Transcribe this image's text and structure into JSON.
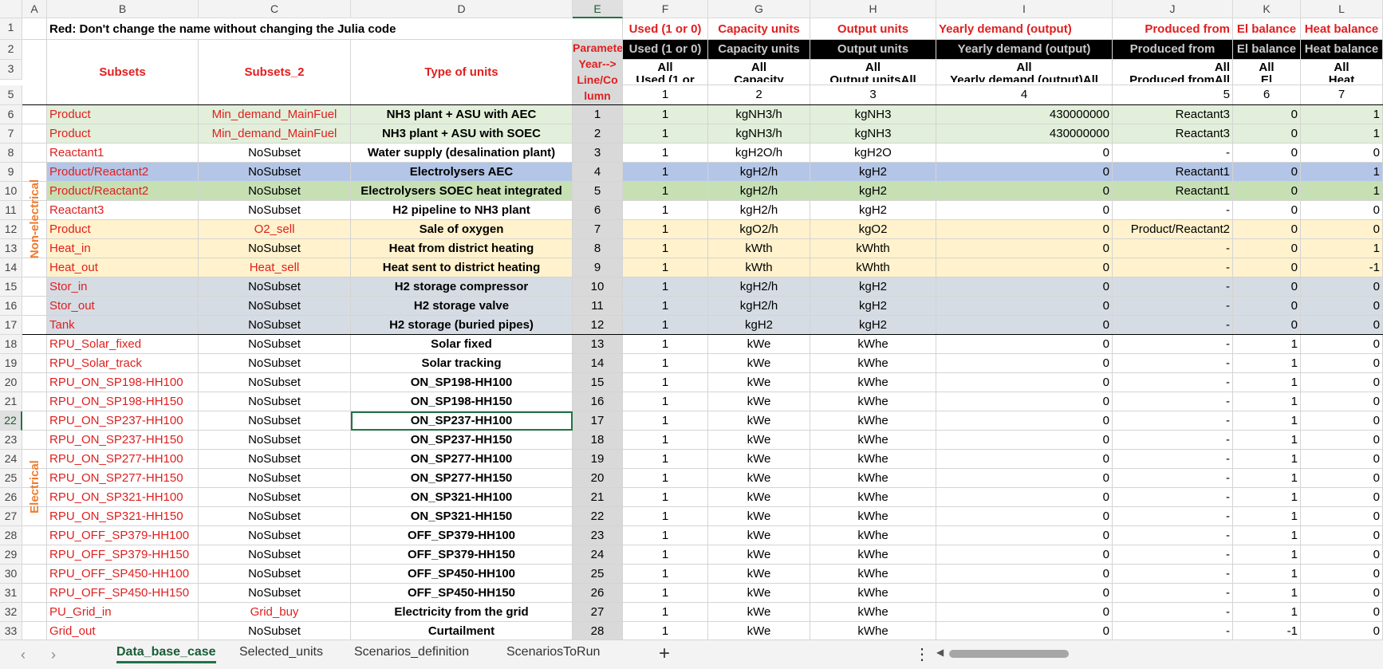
{
  "columns": [
    "A",
    "B",
    "C",
    "D",
    "E",
    "F",
    "G",
    "H",
    "I",
    "J",
    "K",
    "L"
  ],
  "selected_column": "E",
  "selected_row": "22",
  "row1": {
    "B": "Red: Don't change the name without changing the Julia code",
    "F": "Used (1 or 0)",
    "G": "Capacity units",
    "H": "Output units",
    "I": "Yearly demand (output)",
    "J": "Produced from",
    "K": "El balance",
    "L": "Heat balance"
  },
  "row2": {
    "E": "Parameters",
    "F": "Used (1 or 0)",
    "G": "Capacity units",
    "H": "Output units",
    "I": "Yearly demand (output)",
    "J": "Produced from",
    "K": "El balance",
    "L": "Heat balance"
  },
  "row3": {
    "B": "Subsets",
    "C": "Subsets_2",
    "D": "Type of units",
    "E": "Year-->",
    "F": "All",
    "G": "All",
    "H": "All",
    "I": "All",
    "J": "All",
    "K": "All",
    "L": "All"
  },
  "row3b": {
    "E": "Line/Co",
    "F": "Used (1 or",
    "G": "Capacity",
    "H": "Output unitsAll",
    "I": "Yearly demand (output)All",
    "J": "Produced fromAll",
    "K": "El",
    "L": "Heat"
  },
  "row5": {
    "E": "lumn",
    "F": "1",
    "G": "2",
    "H": "3",
    "I": "4",
    "J": "5",
    "K": "6",
    "L": "7"
  },
  "group_labels": {
    "non_electrical": "Non-electrical",
    "electrical": "Electrical"
  },
  "rows": [
    {
      "n": "6",
      "B": "Product",
      "C": "Min_demand_MainFuel",
      "D": "NH3 plant + ASU with AEC",
      "E": "1",
      "F": "1",
      "G": "kgNH3/h",
      "H": "kgNH3",
      "I": "430000000",
      "J": "Reactant3",
      "K": "0",
      "L": "1",
      "fill": "g-green"
    },
    {
      "n": "7",
      "B": "Product",
      "C": "Min_demand_MainFuel",
      "D": "NH3 plant + ASU with SOEC",
      "E": "2",
      "F": "1",
      "G": "kgNH3/h",
      "H": "kgNH3",
      "I": "430000000",
      "J": "Reactant3",
      "K": "0",
      "L": "1",
      "fill": "g-green"
    },
    {
      "n": "8",
      "B": "Reactant1",
      "C": "NoSubset",
      "D": "Water supply (desalination plant)",
      "E": "3",
      "F": "1",
      "G": "kgH2O/h",
      "H": "kgH2O",
      "I": "0",
      "J": "-",
      "K": "0",
      "L": "0",
      "fill": ""
    },
    {
      "n": "9",
      "B": "Product/Reactant2",
      "C": "NoSubset",
      "D": "Electrolysers AEC",
      "E": "4",
      "F": "1",
      "G": "kgH2/h",
      "H": "kgH2",
      "I": "0",
      "J": "Reactant1",
      "K": "0",
      "L": "1",
      "fill": "g-blue"
    },
    {
      "n": "10",
      "B": "Product/Reactant2",
      "C": "NoSubset",
      "D": "Electrolysers SOEC heat integrated",
      "E": "5",
      "F": "1",
      "G": "kgH2/h",
      "H": "kgH2",
      "I": "0",
      "J": "Reactant1",
      "K": "0",
      "L": "1",
      "fill": "g-green2"
    },
    {
      "n": "11",
      "B": "Reactant3",
      "C": "NoSubset",
      "D": "H2 pipeline to NH3 plant",
      "E": "6",
      "F": "1",
      "G": "kgH2/h",
      "H": "kgH2",
      "I": "0",
      "J": "-",
      "K": "0",
      "L": "0",
      "fill": ""
    },
    {
      "n": "12",
      "B": "Product",
      "C": "O2_sell",
      "D": "Sale of oxygen",
      "E": "7",
      "F": "1",
      "G": "kgO2/h",
      "H": "kgO2",
      "I": "0",
      "J": "Product/Reactant2",
      "K": "0",
      "L": "0",
      "fill": "g-orange"
    },
    {
      "n": "13",
      "B": "Heat_in",
      "C": "NoSubset",
      "D": "Heat from district heating",
      "E": "8",
      "F": "1",
      "G": "kWth",
      "H": "kWhth",
      "I": "0",
      "J": "-",
      "K": "0",
      "L": "1",
      "fill": "g-orange"
    },
    {
      "n": "14",
      "B": "Heat_out",
      "C": "Heat_sell",
      "D": "Heat sent to district heating",
      "E": "9",
      "F": "1",
      "G": "kWth",
      "H": "kWhth",
      "I": "0",
      "J": "-",
      "K": "0",
      "L": "-1",
      "fill": "g-orange"
    },
    {
      "n": "15",
      "B": "Stor_in",
      "C": "NoSubset",
      "D": "H2 storage compressor",
      "E": "10",
      "F": "1",
      "G": "kgH2/h",
      "H": "kgH2",
      "I": "0",
      "J": "-",
      "K": "0",
      "L": "0",
      "fill": "g-steel"
    },
    {
      "n": "16",
      "B": "Stor_out",
      "C": "NoSubset",
      "D": "H2 storage valve",
      "E": "11",
      "F": "1",
      "G": "kgH2/h",
      "H": "kgH2",
      "I": "0",
      "J": "-",
      "K": "0",
      "L": "0",
      "fill": "g-steel"
    },
    {
      "n": "17",
      "B": "Tank",
      "C": "NoSubset",
      "D": "H2 storage (buried pipes)",
      "E": "12",
      "F": "1",
      "G": "kgH2",
      "H": "kgH2",
      "I": "0",
      "J": "-",
      "K": "0",
      "L": "0",
      "fill": "g-steel"
    },
    {
      "n": "18",
      "B": "RPU_Solar_fixed",
      "C": "NoSubset",
      "D": "Solar fixed",
      "E": "13",
      "F": "1",
      "G": "kWe",
      "H": "kWhe",
      "I": "0",
      "J": "-",
      "K": "1",
      "L": "0",
      "fill": ""
    },
    {
      "n": "19",
      "B": "RPU_Solar_track",
      "C": "NoSubset",
      "D": "Solar tracking",
      "E": "14",
      "F": "1",
      "G": "kWe",
      "H": "kWhe",
      "I": "0",
      "J": "-",
      "K": "1",
      "L": "0",
      "fill": ""
    },
    {
      "n": "20",
      "B": "RPU_ON_SP198-HH100",
      "C": "NoSubset",
      "D": "ON_SP198-HH100",
      "E": "15",
      "F": "1",
      "G": "kWe",
      "H": "kWhe",
      "I": "0",
      "J": "-",
      "K": "1",
      "L": "0",
      "fill": ""
    },
    {
      "n": "21",
      "B": "RPU_ON_SP198-HH150",
      "C": "NoSubset",
      "D": "ON_SP198-HH150",
      "E": "16",
      "F": "1",
      "G": "kWe",
      "H": "kWhe",
      "I": "0",
      "J": "-",
      "K": "1",
      "L": "0",
      "fill": ""
    },
    {
      "n": "22",
      "B": "RPU_ON_SP237-HH100",
      "C": "NoSubset",
      "D": "ON_SP237-HH100",
      "E": "17",
      "F": "1",
      "G": "kWe",
      "H": "kWhe",
      "I": "0",
      "J": "-",
      "K": "1",
      "L": "0",
      "fill": ""
    },
    {
      "n": "23",
      "B": "RPU_ON_SP237-HH150",
      "C": "NoSubset",
      "D": "ON_SP237-HH150",
      "E": "18",
      "F": "1",
      "G": "kWe",
      "H": "kWhe",
      "I": "0",
      "J": "-",
      "K": "1",
      "L": "0",
      "fill": ""
    },
    {
      "n": "24",
      "B": "RPU_ON_SP277-HH100",
      "C": "NoSubset",
      "D": "ON_SP277-HH100",
      "E": "19",
      "F": "1",
      "G": "kWe",
      "H": "kWhe",
      "I": "0",
      "J": "-",
      "K": "1",
      "L": "0",
      "fill": ""
    },
    {
      "n": "25",
      "B": "RPU_ON_SP277-HH150",
      "C": "NoSubset",
      "D": "ON_SP277-HH150",
      "E": "20",
      "F": "1",
      "G": "kWe",
      "H": "kWhe",
      "I": "0",
      "J": "-",
      "K": "1",
      "L": "0",
      "fill": ""
    },
    {
      "n": "26",
      "B": "RPU_ON_SP321-HH100",
      "C": "NoSubset",
      "D": "ON_SP321-HH100",
      "E": "21",
      "F": "1",
      "G": "kWe",
      "H": "kWhe",
      "I": "0",
      "J": "-",
      "K": "1",
      "L": "0",
      "fill": ""
    },
    {
      "n": "27",
      "B": "RPU_ON_SP321-HH150",
      "C": "NoSubset",
      "D": "ON_SP321-HH150",
      "E": "22",
      "F": "1",
      "G": "kWe",
      "H": "kWhe",
      "I": "0",
      "J": "-",
      "K": "1",
      "L": "0",
      "fill": ""
    },
    {
      "n": "28",
      "B": "RPU_OFF_SP379-HH100",
      "C": "NoSubset",
      "D": "OFF_SP379-HH100",
      "E": "23",
      "F": "1",
      "G": "kWe",
      "H": "kWhe",
      "I": "0",
      "J": "-",
      "K": "1",
      "L": "0",
      "fill": ""
    },
    {
      "n": "29",
      "B": "RPU_OFF_SP379-HH150",
      "C": "NoSubset",
      "D": "OFF_SP379-HH150",
      "E": "24",
      "F": "1",
      "G": "kWe",
      "H": "kWhe",
      "I": "0",
      "J": "-",
      "K": "1",
      "L": "0",
      "fill": ""
    },
    {
      "n": "30",
      "B": "RPU_OFF_SP450-HH100",
      "C": "NoSubset",
      "D": "OFF_SP450-HH100",
      "E": "25",
      "F": "1",
      "G": "kWe",
      "H": "kWhe",
      "I": "0",
      "J": "-",
      "K": "1",
      "L": "0",
      "fill": ""
    },
    {
      "n": "31",
      "B": "RPU_OFF_SP450-HH150",
      "C": "NoSubset",
      "D": "OFF_SP450-HH150",
      "E": "26",
      "F": "1",
      "G": "kWe",
      "H": "kWhe",
      "I": "0",
      "J": "-",
      "K": "1",
      "L": "0",
      "fill": ""
    },
    {
      "n": "32",
      "B": "PU_Grid_in",
      "C": "Grid_buy",
      "D": "Electricity from the grid",
      "E": "27",
      "F": "1",
      "G": "kWe",
      "H": "kWhe",
      "I": "0",
      "J": "-",
      "K": "1",
      "L": "0",
      "fill": ""
    },
    {
      "n": "33",
      "B": "Grid_out",
      "C": "NoSubset",
      "D": "Curtailment",
      "E": "28",
      "F": "1",
      "G": "kWe",
      "H": "kWhe",
      "I": "0",
      "J": "-",
      "K": "-1",
      "L": "0",
      "fill": ""
    }
  ],
  "red_C": [
    "Min_demand_MainFuel",
    "O2_sell",
    "Heat_sell",
    "Grid_buy"
  ],
  "tabs": [
    "Data_base_case",
    "Selected_units",
    "Scenarios_definition",
    "ScenariosToRun"
  ],
  "active_tab": "Data_base_case",
  "icons": {
    "prev": "chevron-left-icon",
    "next": "chevron-right-icon",
    "add": "plus-icon",
    "more": "more-vertical-icon"
  },
  "colors": {
    "accent": "#217346",
    "red": "#e01f1f",
    "orange": "#ed7d31"
  }
}
